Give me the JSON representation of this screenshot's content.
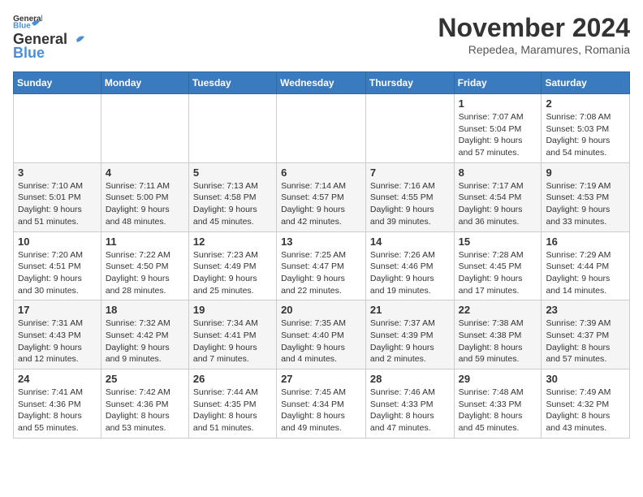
{
  "logo": {
    "general": "General",
    "blue": "Blue"
  },
  "title": {
    "month_year": "November 2024",
    "location": "Repedea, Maramures, Romania"
  },
  "days_of_week": [
    "Sunday",
    "Monday",
    "Tuesday",
    "Wednesday",
    "Thursday",
    "Friday",
    "Saturday"
  ],
  "weeks": [
    [
      {
        "day": "",
        "info": ""
      },
      {
        "day": "",
        "info": ""
      },
      {
        "day": "",
        "info": ""
      },
      {
        "day": "",
        "info": ""
      },
      {
        "day": "",
        "info": ""
      },
      {
        "day": "1",
        "info": "Sunrise: 7:07 AM\nSunset: 5:04 PM\nDaylight: 9 hours and 57 minutes."
      },
      {
        "day": "2",
        "info": "Sunrise: 7:08 AM\nSunset: 5:03 PM\nDaylight: 9 hours and 54 minutes."
      }
    ],
    [
      {
        "day": "3",
        "info": "Sunrise: 7:10 AM\nSunset: 5:01 PM\nDaylight: 9 hours and 51 minutes."
      },
      {
        "day": "4",
        "info": "Sunrise: 7:11 AM\nSunset: 5:00 PM\nDaylight: 9 hours and 48 minutes."
      },
      {
        "day": "5",
        "info": "Sunrise: 7:13 AM\nSunset: 4:58 PM\nDaylight: 9 hours and 45 minutes."
      },
      {
        "day": "6",
        "info": "Sunrise: 7:14 AM\nSunset: 4:57 PM\nDaylight: 9 hours and 42 minutes."
      },
      {
        "day": "7",
        "info": "Sunrise: 7:16 AM\nSunset: 4:55 PM\nDaylight: 9 hours and 39 minutes."
      },
      {
        "day": "8",
        "info": "Sunrise: 7:17 AM\nSunset: 4:54 PM\nDaylight: 9 hours and 36 minutes."
      },
      {
        "day": "9",
        "info": "Sunrise: 7:19 AM\nSunset: 4:53 PM\nDaylight: 9 hours and 33 minutes."
      }
    ],
    [
      {
        "day": "10",
        "info": "Sunrise: 7:20 AM\nSunset: 4:51 PM\nDaylight: 9 hours and 30 minutes."
      },
      {
        "day": "11",
        "info": "Sunrise: 7:22 AM\nSunset: 4:50 PM\nDaylight: 9 hours and 28 minutes."
      },
      {
        "day": "12",
        "info": "Sunrise: 7:23 AM\nSunset: 4:49 PM\nDaylight: 9 hours and 25 minutes."
      },
      {
        "day": "13",
        "info": "Sunrise: 7:25 AM\nSunset: 4:47 PM\nDaylight: 9 hours and 22 minutes."
      },
      {
        "day": "14",
        "info": "Sunrise: 7:26 AM\nSunset: 4:46 PM\nDaylight: 9 hours and 19 minutes."
      },
      {
        "day": "15",
        "info": "Sunrise: 7:28 AM\nSunset: 4:45 PM\nDaylight: 9 hours and 17 minutes."
      },
      {
        "day": "16",
        "info": "Sunrise: 7:29 AM\nSunset: 4:44 PM\nDaylight: 9 hours and 14 minutes."
      }
    ],
    [
      {
        "day": "17",
        "info": "Sunrise: 7:31 AM\nSunset: 4:43 PM\nDaylight: 9 hours and 12 minutes."
      },
      {
        "day": "18",
        "info": "Sunrise: 7:32 AM\nSunset: 4:42 PM\nDaylight: 9 hours and 9 minutes."
      },
      {
        "day": "19",
        "info": "Sunrise: 7:34 AM\nSunset: 4:41 PM\nDaylight: 9 hours and 7 minutes."
      },
      {
        "day": "20",
        "info": "Sunrise: 7:35 AM\nSunset: 4:40 PM\nDaylight: 9 hours and 4 minutes."
      },
      {
        "day": "21",
        "info": "Sunrise: 7:37 AM\nSunset: 4:39 PM\nDaylight: 9 hours and 2 minutes."
      },
      {
        "day": "22",
        "info": "Sunrise: 7:38 AM\nSunset: 4:38 PM\nDaylight: 8 hours and 59 minutes."
      },
      {
        "day": "23",
        "info": "Sunrise: 7:39 AM\nSunset: 4:37 PM\nDaylight: 8 hours and 57 minutes."
      }
    ],
    [
      {
        "day": "24",
        "info": "Sunrise: 7:41 AM\nSunset: 4:36 PM\nDaylight: 8 hours and 55 minutes."
      },
      {
        "day": "25",
        "info": "Sunrise: 7:42 AM\nSunset: 4:36 PM\nDaylight: 8 hours and 53 minutes."
      },
      {
        "day": "26",
        "info": "Sunrise: 7:44 AM\nSunset: 4:35 PM\nDaylight: 8 hours and 51 minutes."
      },
      {
        "day": "27",
        "info": "Sunrise: 7:45 AM\nSunset: 4:34 PM\nDaylight: 8 hours and 49 minutes."
      },
      {
        "day": "28",
        "info": "Sunrise: 7:46 AM\nSunset: 4:33 PM\nDaylight: 8 hours and 47 minutes."
      },
      {
        "day": "29",
        "info": "Sunrise: 7:48 AM\nSunset: 4:33 PM\nDaylight: 8 hours and 45 minutes."
      },
      {
        "day": "30",
        "info": "Sunrise: 7:49 AM\nSunset: 4:32 PM\nDaylight: 8 hours and 43 minutes."
      }
    ]
  ]
}
